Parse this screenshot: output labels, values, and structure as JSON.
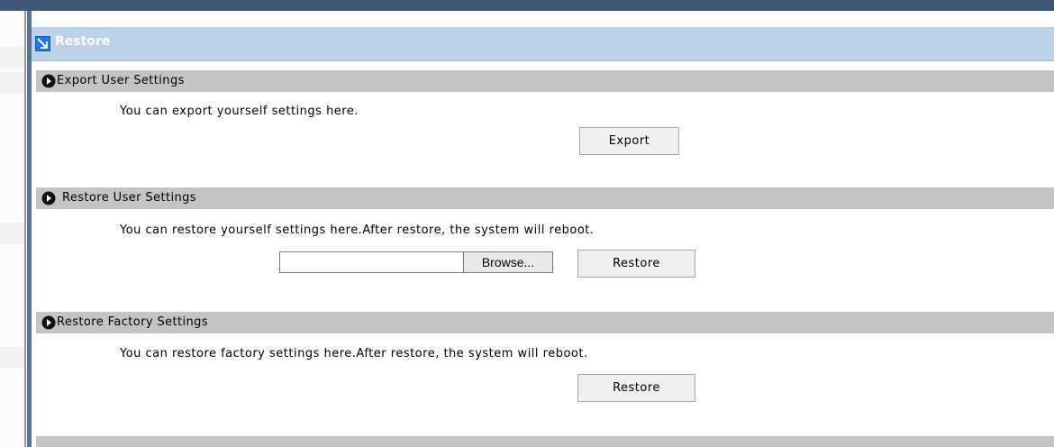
{
  "panel": {
    "title": "Restore"
  },
  "sections": {
    "export": {
      "title": "Export User Settings",
      "description": "You can export yourself settings here.",
      "button": "Export"
    },
    "restore_user": {
      "title": "Restore User Settings",
      "description": "You can restore yourself settings here.After restore, the system will reboot.",
      "file_value": "",
      "browse_button": "Browse...",
      "button": "Restore"
    },
    "restore_factory": {
      "title": "Restore Factory Settings",
      "description": "You can restore factory settings here.After restore, the system will reboot.",
      "button": "Restore"
    }
  },
  "icons": {
    "panel": "expand-arrow-icon",
    "section": "circle-arrow-icon"
  },
  "colors": {
    "topbar": "#3d5676",
    "title_bar": "#bcd0e8",
    "section_header": "#c4c4c4",
    "title_icon": "#1d77e6"
  }
}
